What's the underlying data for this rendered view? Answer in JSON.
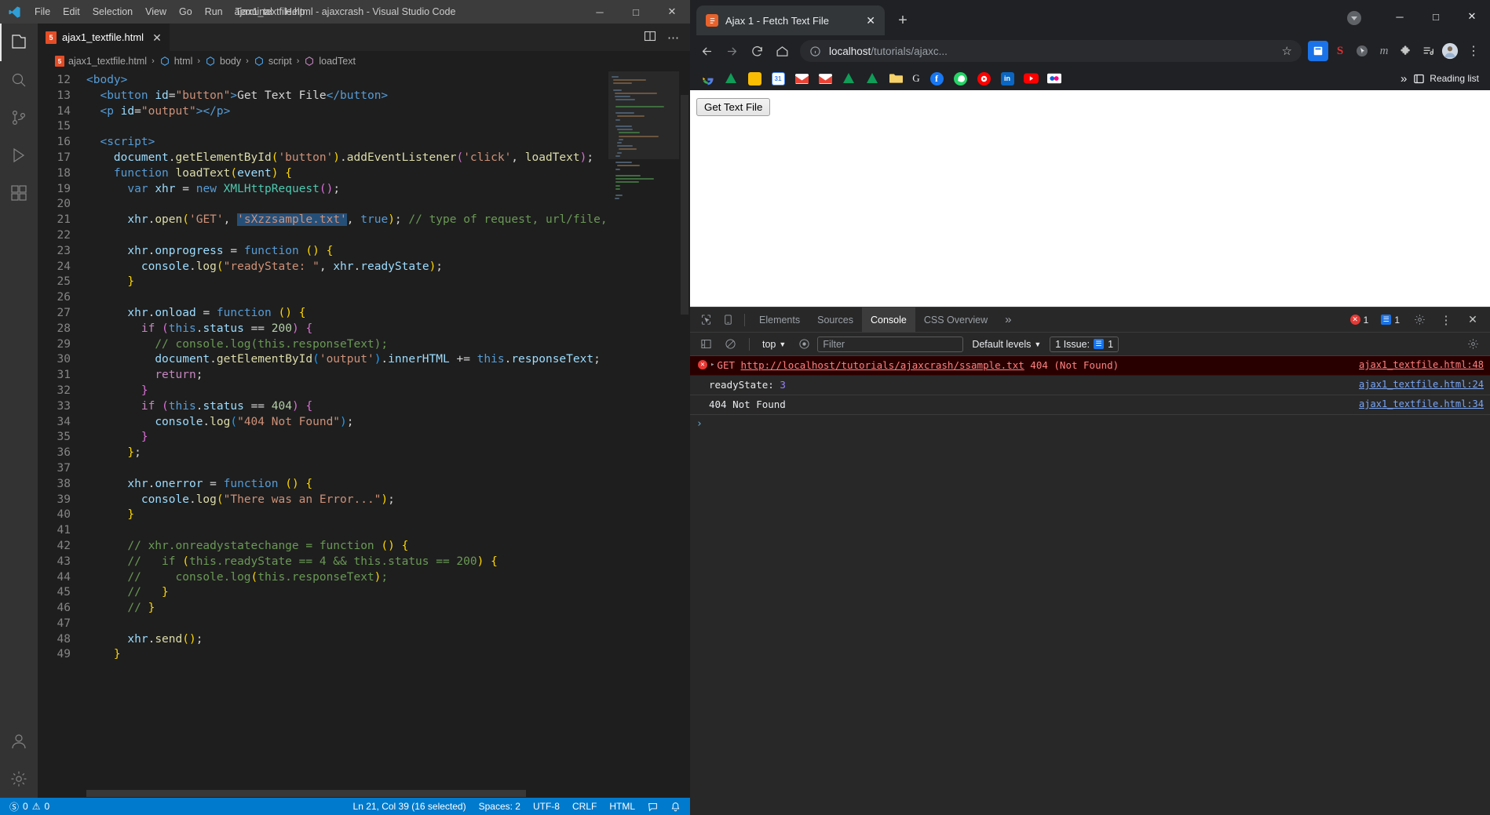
{
  "vscode": {
    "menu": [
      "File",
      "Edit",
      "Selection",
      "View",
      "Go",
      "Run",
      "Terminal",
      "Help"
    ],
    "window_title": "ajax1_textfile.html - ajaxcrash - Visual Studio Code",
    "window_buttons": {
      "minimize": "─",
      "maximize": "□",
      "close": "✕"
    },
    "tab": {
      "label": "ajax1_textfile.html",
      "close": "✕",
      "badge": "5"
    },
    "tab_actions": {
      "split_editor": "split-editor",
      "more": "⋯"
    },
    "breadcrumbs": [
      "ajax1_textfile.html",
      "html",
      "body",
      "script",
      "loadText"
    ],
    "editor": {
      "first_line_number": 12,
      "lines": [
        {
          "n": 12,
          "html": "<span style='color:#569cd6'>&lt;body&gt;</span>"
        },
        {
          "n": 13,
          "html": "  <span style='color:#569cd6'>&lt;button</span> <span style='color:#9cdcfe'>id</span><span style='color:#d4d4d4'>=</span><span style='color:#ce9178'>\"button\"</span><span style='color:#569cd6'>&gt;</span><span style='color:#d4d4d4'>Get Text File</span><span style='color:#569cd6'>&lt;/button&gt;</span>"
        },
        {
          "n": 14,
          "html": "  <span style='color:#569cd6'>&lt;p</span> <span style='color:#9cdcfe'>id</span><span style='color:#d4d4d4'>=</span><span style='color:#ce9178'>\"output\"</span><span style='color:#569cd6'>&gt;&lt;/p&gt;</span>"
        },
        {
          "n": 15,
          "html": ""
        },
        {
          "n": 16,
          "html": "  <span style='color:#569cd6'>&lt;script&gt;</span>"
        },
        {
          "n": 17,
          "html": "    <span style='color:#9cdcfe'>document</span><span style='color:#d4d4d4'>.</span><span style='color:#dcdcaa'>getElementById</span><span style='color:#ffd700'>(</span><span style='color:#ce9178'>'button'</span><span style='color:#ffd700'>)</span><span style='color:#d4d4d4'>.</span><span style='color:#dcdcaa'>addEventListener</span><span style='color:#da70d6'>(</span><span style='color:#ce9178'>'click'</span><span style='color:#d4d4d4'>, </span><span style='color:#dcdcaa'>loadText</span><span style='color:#da70d6'>)</span><span style='color:#d4d4d4'>;</span>"
        },
        {
          "n": 18,
          "html": "    <span style='color:#569cd6'>function</span> <span style='color:#dcdcaa'>loadText</span><span style='color:#ffd700'>(</span><span style='color:#9cdcfe'>event</span><span style='color:#ffd700'>)</span> <span style='color:#ffd700'>{</span>"
        },
        {
          "n": 19,
          "html": "      <span style='color:#569cd6'>var</span> <span style='color:#9cdcfe'>xhr</span> <span style='color:#d4d4d4'>=</span> <span style='color:#569cd6'>new</span> <span style='color:#4ec9b0'>XMLHttpRequest</span><span style='color:#da70d6'>()</span><span style='color:#d4d4d4'>;</span>"
        },
        {
          "n": 20,
          "html": ""
        },
        {
          "n": 21,
          "html": "      <span style='color:#9cdcfe'>xhr</span><span style='color:#d4d4d4'>.</span><span style='color:#dcdcaa'>open</span><span style='color:#ffd700'>(</span><span style='color:#ce9178'>'GET'</span><span style='color:#d4d4d4'>, </span><span class='sel'><span style='color:#ce9178'>'sXzzsample.txt'</span></span><span style='color:#d4d4d4'>, </span><span style='color:#569cd6'>true</span><span style='color:#ffd700'>)</span><span style='color:#d4d4d4'>; </span><span style='color:#6a9955'>// type of request, url/file, async or</span>"
        },
        {
          "n": 22,
          "html": ""
        },
        {
          "n": 23,
          "html": "      <span style='color:#9cdcfe'>xhr</span><span style='color:#d4d4d4'>.</span><span style='color:#9cdcfe'>onprogress</span> <span style='color:#d4d4d4'>=</span> <span style='color:#569cd6'>function</span> <span style='color:#ffd700'>()</span> <span style='color:#ffd700'>{</span>"
        },
        {
          "n": 24,
          "html": "        <span style='color:#9cdcfe'>console</span><span style='color:#d4d4d4'>.</span><span style='color:#dcdcaa'>log</span><span style='color:#ffd700'>(</span><span style='color:#ce9178'>\"readyState: \"</span><span style='color:#d4d4d4'>, </span><span style='color:#9cdcfe'>xhr</span><span style='color:#d4d4d4'>.</span><span style='color:#9cdcfe'>readyState</span><span style='color:#ffd700'>)</span><span style='color:#d4d4d4'>;</span>"
        },
        {
          "n": 25,
          "html": "      <span style='color:#ffd700'>}</span>"
        },
        {
          "n": 26,
          "html": ""
        },
        {
          "n": 27,
          "html": "      <span style='color:#9cdcfe'>xhr</span><span style='color:#d4d4d4'>.</span><span style='color:#9cdcfe'>onload</span> <span style='color:#d4d4d4'>=</span> <span style='color:#569cd6'>function</span> <span style='color:#ffd700'>()</span> <span style='color:#ffd700'>{</span>"
        },
        {
          "n": 28,
          "html": "        <span style='color:#c586c0'>if</span> <span style='color:#da70d6'>(</span><span style='color:#569cd6'>this</span><span style='color:#d4d4d4'>.</span><span style='color:#9cdcfe'>status</span> <span style='color:#d4d4d4'>==</span> <span style='color:#b5cea8'>200</span><span style='color:#da70d6'>)</span> <span style='color:#da70d6'>{</span>"
        },
        {
          "n": 29,
          "html": "          <span style='color:#6a9955'>// console.log(this.responseText);</span>"
        },
        {
          "n": 30,
          "html": "          <span style='color:#9cdcfe'>document</span><span style='color:#d4d4d4'>.</span><span style='color:#dcdcaa'>getElementById</span><span style='color:#179fff'>(</span><span style='color:#ce9178'>'output'</span><span style='color:#179fff'>)</span><span style='color:#d4d4d4'>.</span><span style='color:#9cdcfe'>innerHTML</span> <span style='color:#d4d4d4'>+=</span> <span style='color:#569cd6'>this</span><span style='color:#d4d4d4'>.</span><span style='color:#9cdcfe'>responseText</span><span style='color:#d4d4d4'>;</span>"
        },
        {
          "n": 31,
          "html": "          <span style='color:#c586c0'>return</span><span style='color:#d4d4d4'>;</span>"
        },
        {
          "n": 32,
          "html": "        <span style='color:#da70d6'>}</span>"
        },
        {
          "n": 33,
          "html": "        <span style='color:#c586c0'>if</span> <span style='color:#da70d6'>(</span><span style='color:#569cd6'>this</span><span style='color:#d4d4d4'>.</span><span style='color:#9cdcfe'>status</span> <span style='color:#d4d4d4'>==</span> <span style='color:#b5cea8'>404</span><span style='color:#da70d6'>)</span> <span style='color:#da70d6'>{</span>"
        },
        {
          "n": 34,
          "html": "          <span style='color:#9cdcfe'>console</span><span style='color:#d4d4d4'>.</span><span style='color:#dcdcaa'>log</span><span style='color:#179fff'>(</span><span style='color:#ce9178'>\"404 Not Found\"</span><span style='color:#179fff'>)</span><span style='color:#d4d4d4'>;</span>"
        },
        {
          "n": 35,
          "html": "        <span style='color:#da70d6'>}</span>"
        },
        {
          "n": 36,
          "html": "      <span style='color:#ffd700'>}</span><span style='color:#d4d4d4'>;</span>"
        },
        {
          "n": 37,
          "html": ""
        },
        {
          "n": 38,
          "html": "      <span style='color:#9cdcfe'>xhr</span><span style='color:#d4d4d4'>.</span><span style='color:#9cdcfe'>onerror</span> <span style='color:#d4d4d4'>=</span> <span style='color:#569cd6'>function</span> <span style='color:#ffd700'>()</span> <span style='color:#ffd700'>{</span>"
        },
        {
          "n": 39,
          "html": "        <span style='color:#9cdcfe'>console</span><span style='color:#d4d4d4'>.</span><span style='color:#dcdcaa'>log</span><span style='color:#ffd700'>(</span><span style='color:#ce9178'>\"There was an Error...\"</span><span style='color:#ffd700'>)</span><span style='color:#d4d4d4'>;</span>"
        },
        {
          "n": 40,
          "html": "      <span style='color:#ffd700'>}</span>"
        },
        {
          "n": 41,
          "html": ""
        },
        {
          "n": 42,
          "html": "      <span style='color:#6a9955'>// xhr.onreadystatechange = function </span><span style='color:#ffd700'>()</span> <span style='color:#ffd700'>{</span>"
        },
        {
          "n": 43,
          "html": "      <span style='color:#6a9955'>//   if </span><span style='color:#ffd700'>(</span><span style='color:#6a9955'>this.readyState == 4 &amp;&amp; this.status == 200</span><span style='color:#ffd700'>)</span> <span style='color:#ffd700'>{</span>"
        },
        {
          "n": 44,
          "html": "      <span style='color:#6a9955'>//     console.log</span><span style='color:#ffd700'>(</span><span style='color:#6a9955'>this.responseText</span><span style='color:#ffd700'>)</span><span style='color:#6a9955'>;</span>"
        },
        {
          "n": 45,
          "html": "      <span style='color:#6a9955'>//   </span><span style='color:#ffd700'>}</span>"
        },
        {
          "n": 46,
          "html": "      <span style='color:#6a9955'>// </span><span style='color:#ffd700'>}</span>"
        },
        {
          "n": 47,
          "html": ""
        },
        {
          "n": 48,
          "html": "      <span style='color:#9cdcfe'>xhr</span><span style='color:#d4d4d4'>.</span><span style='color:#dcdcaa'>send</span><span style='color:#ffd700'>()</span><span style='color:#d4d4d4'>;</span>"
        },
        {
          "n": 49,
          "html": "    <span style='color:#ffd700'>}</span>"
        }
      ]
    },
    "statusbar": {
      "errors": "0",
      "warnings": "0",
      "cursor": "Ln 21, Col 39 (16 selected)",
      "spaces": "Spaces: 2",
      "encoding": "UTF-8",
      "eol": "CRLF",
      "language": "HTML",
      "feedback_icon": "smiley-icon",
      "bell_icon": "bell-icon"
    }
  },
  "chrome": {
    "tab": {
      "title": "Ajax 1 - Fetch Text File",
      "close": "✕"
    },
    "new_tab": "+",
    "window_buttons": {
      "minimize": "─",
      "maximize": "□",
      "close": "✕"
    },
    "toolbar": {
      "back": "back-icon",
      "forward": "forward-icon",
      "reload": "reload-icon",
      "home": "home-icon",
      "url_host": "localhost",
      "url_path": "/tutorials/ajaxc...",
      "bookmark_star": "☆",
      "menu": "⋮"
    },
    "bookmarks": [
      {
        "name": "google",
        "glyph": "G",
        "color": "#ffffff",
        "shape": "round-multi"
      },
      {
        "name": "green-pin",
        "glyph": "",
        "color": "#34a853",
        "shape": "triangle"
      },
      {
        "name": "keep",
        "glyph": "",
        "color": "#fbbc04",
        "shape": "square"
      },
      {
        "name": "calendar",
        "glyph": "31",
        "color": "#1a73e8",
        "shape": "square"
      },
      {
        "name": "gmail-1",
        "glyph": "M",
        "color": "#ea4335",
        "shape": "square"
      },
      {
        "name": "gmail-2",
        "glyph": "M",
        "color": "#ea4335",
        "shape": "square"
      },
      {
        "name": "drive-1",
        "glyph": "",
        "color": "#34a853",
        "shape": "triangle"
      },
      {
        "name": "drive-2",
        "glyph": "",
        "color": "#34a853",
        "shape": "triangle"
      },
      {
        "name": "folder",
        "glyph": "",
        "color": "#f9d36c",
        "shape": "square"
      },
      {
        "name": "google-g",
        "glyph": "G",
        "color": "#e8eaed",
        "shape": "text"
      },
      {
        "name": "facebook",
        "glyph": "f",
        "color": "#1877f2",
        "shape": "round"
      },
      {
        "name": "whatsapp",
        "glyph": "",
        "color": "#25d366",
        "shape": "round"
      },
      {
        "name": "youtube-music",
        "glyph": "",
        "color": "#ff0000",
        "shape": "round"
      },
      {
        "name": "linkedin",
        "glyph": "in",
        "color": "#0a66c2",
        "shape": "square"
      },
      {
        "name": "youtube",
        "glyph": "",
        "color": "#ff0000",
        "shape": "square"
      },
      {
        "name": "flickr",
        "glyph": "",
        "color": "#ffffff",
        "shape": "square"
      }
    ],
    "bookmarks_overflow": "»",
    "reading_list": "Reading list",
    "page": {
      "button_label": "Get Text File"
    },
    "extensions": [
      {
        "name": "extension-blue",
        "glyph": "",
        "color": "#4285f4"
      },
      {
        "name": "sophos-extension",
        "glyph": "S",
        "color": "#e03131"
      },
      {
        "name": "cursor-extension",
        "glyph": "",
        "color": "#5f6368"
      },
      {
        "name": "m-extension",
        "glyph": "m",
        "color": "#9aa0a6"
      },
      {
        "name": "puzzle-extension",
        "glyph": "",
        "color": "#c4c7c5"
      },
      {
        "name": "reading-list-extension",
        "glyph": "",
        "color": "#c4c7c5"
      },
      {
        "name": "profile-avatar",
        "glyph": "",
        "color": "#6d9eeb"
      }
    ]
  },
  "devtools": {
    "tabs": [
      {
        "label": "Elements",
        "active": false
      },
      {
        "label": "Sources",
        "active": false
      },
      {
        "label": "Console",
        "active": true
      },
      {
        "label": "CSS Overview",
        "active": false
      }
    ],
    "overflow": "»",
    "error_count": "1",
    "message_count": "1",
    "settings_icon": "gear-icon",
    "more_icon": "⋮",
    "close_icon": "✕",
    "toolbar": {
      "sidebar_icon": "sidebar-icon",
      "clear_icon": "clear-console-icon",
      "context": "top",
      "eye_icon": "live-expression-icon",
      "filter_placeholder": "Filter",
      "levels": "Default levels",
      "issues_label": "1 Issue:",
      "issues_count": "1",
      "settings_icon": "gear-icon"
    },
    "messages": [
      {
        "type": "error",
        "expandable": true,
        "prefix": "GET ",
        "url": "http://localhost/tutorials/ajaxcrash/ssample.txt",
        "suffix": " 404 (Not Found)",
        "source": "ajax1_textfile.html:48"
      },
      {
        "type": "log",
        "expandable": false,
        "label": "readyState: ",
        "value": "3",
        "source": "ajax1_textfile.html:24"
      },
      {
        "type": "log",
        "expandable": false,
        "label": "404 Not Found",
        "value": "",
        "source": "ajax1_textfile.html:34"
      }
    ],
    "prompt": "›"
  }
}
